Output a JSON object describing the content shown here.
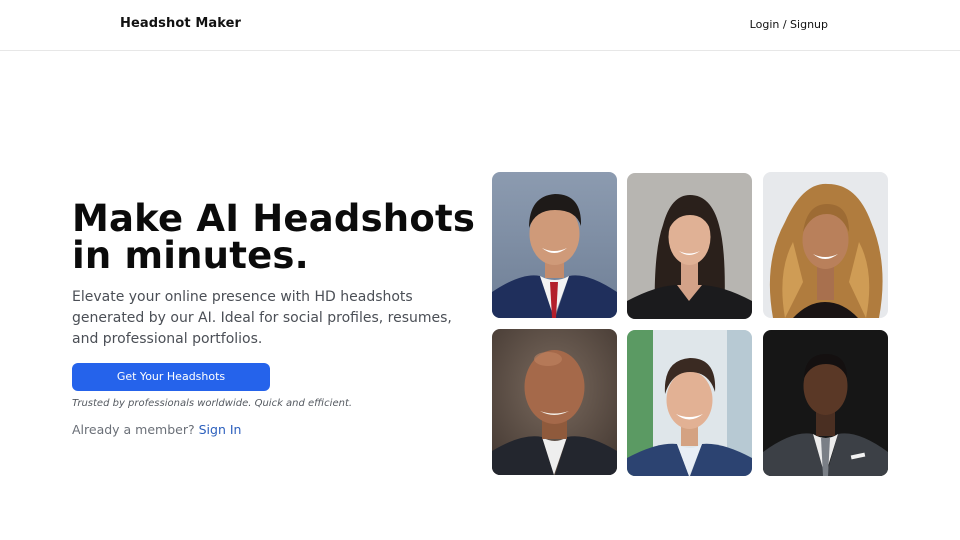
{
  "nav": {
    "brand": "Headshot Maker",
    "login_label": "Login / Signup"
  },
  "hero": {
    "headline_line1": "Make AI Headshots",
    "headline_line2": "in minutes.",
    "subtext": "Elevate your online presence with HD headshots generated by our AI. Ideal for social profiles, resumes, and professional portfolios.",
    "cta_label": "Get Your Headshots",
    "trust_text": "Trusted by professionals worldwide. Quick and efficient.",
    "member_prompt": "Already a member?",
    "signin_label": "Sign In"
  },
  "colors": {
    "accent": "#2563eb",
    "link": "#2b5fbd"
  }
}
